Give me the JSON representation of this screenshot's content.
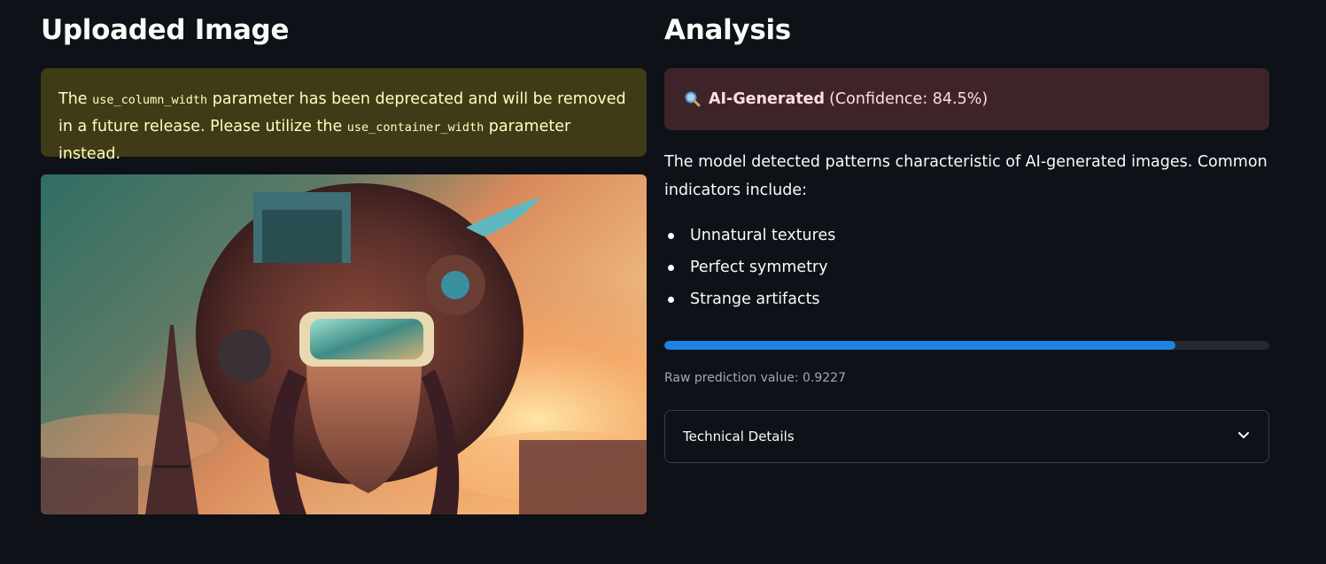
{
  "left": {
    "title": "Uploaded Image",
    "warning": {
      "part1": "The ",
      "code1": "use_column_width",
      "part2": " parameter has been deprecated and will be removed in a future release. Please utilize the ",
      "code2": "use_container_width",
      "part3": " parameter instead."
    },
    "image_icon": "uploaded-image"
  },
  "right": {
    "title": "Analysis",
    "result": {
      "icon": "magnifier-icon",
      "label": "AI-Generated",
      "confidence": "(Confidence: 84.5%)"
    },
    "description": "The model detected patterns characteristic of AI-generated images. Common indicators include:",
    "indicators": [
      "Unnatural textures",
      "Perfect symmetry",
      "Strange artifacts"
    ],
    "progress_value": 0.8449,
    "raw_prediction": "Raw prediction value: 0.9227",
    "expander_label": "Technical Details"
  },
  "colors": {
    "background": "#0e1117",
    "warning_bg": "#3e3b16",
    "warning_text": "#ffffc2",
    "error_bg": "#3e2428",
    "error_text": "#ffdede",
    "progress_fill": "#1c83e1",
    "progress_track": "#262730"
  }
}
